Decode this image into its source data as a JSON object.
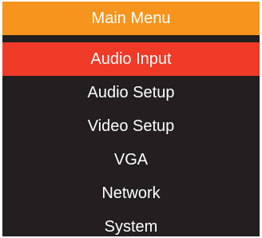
{
  "menu": {
    "title": "Main Menu",
    "selected_index": 0,
    "items": [
      {
        "label": "Audio Input"
      },
      {
        "label": "Audio Setup"
      },
      {
        "label": "Video Setup"
      },
      {
        "label": "VGA"
      },
      {
        "label": "Network"
      },
      {
        "label": "System"
      }
    ]
  },
  "colors": {
    "header_bg": "#f7941d",
    "selected_bg": "#ef3a27",
    "menu_bg": "#231f20",
    "text": "#ffffff"
  }
}
